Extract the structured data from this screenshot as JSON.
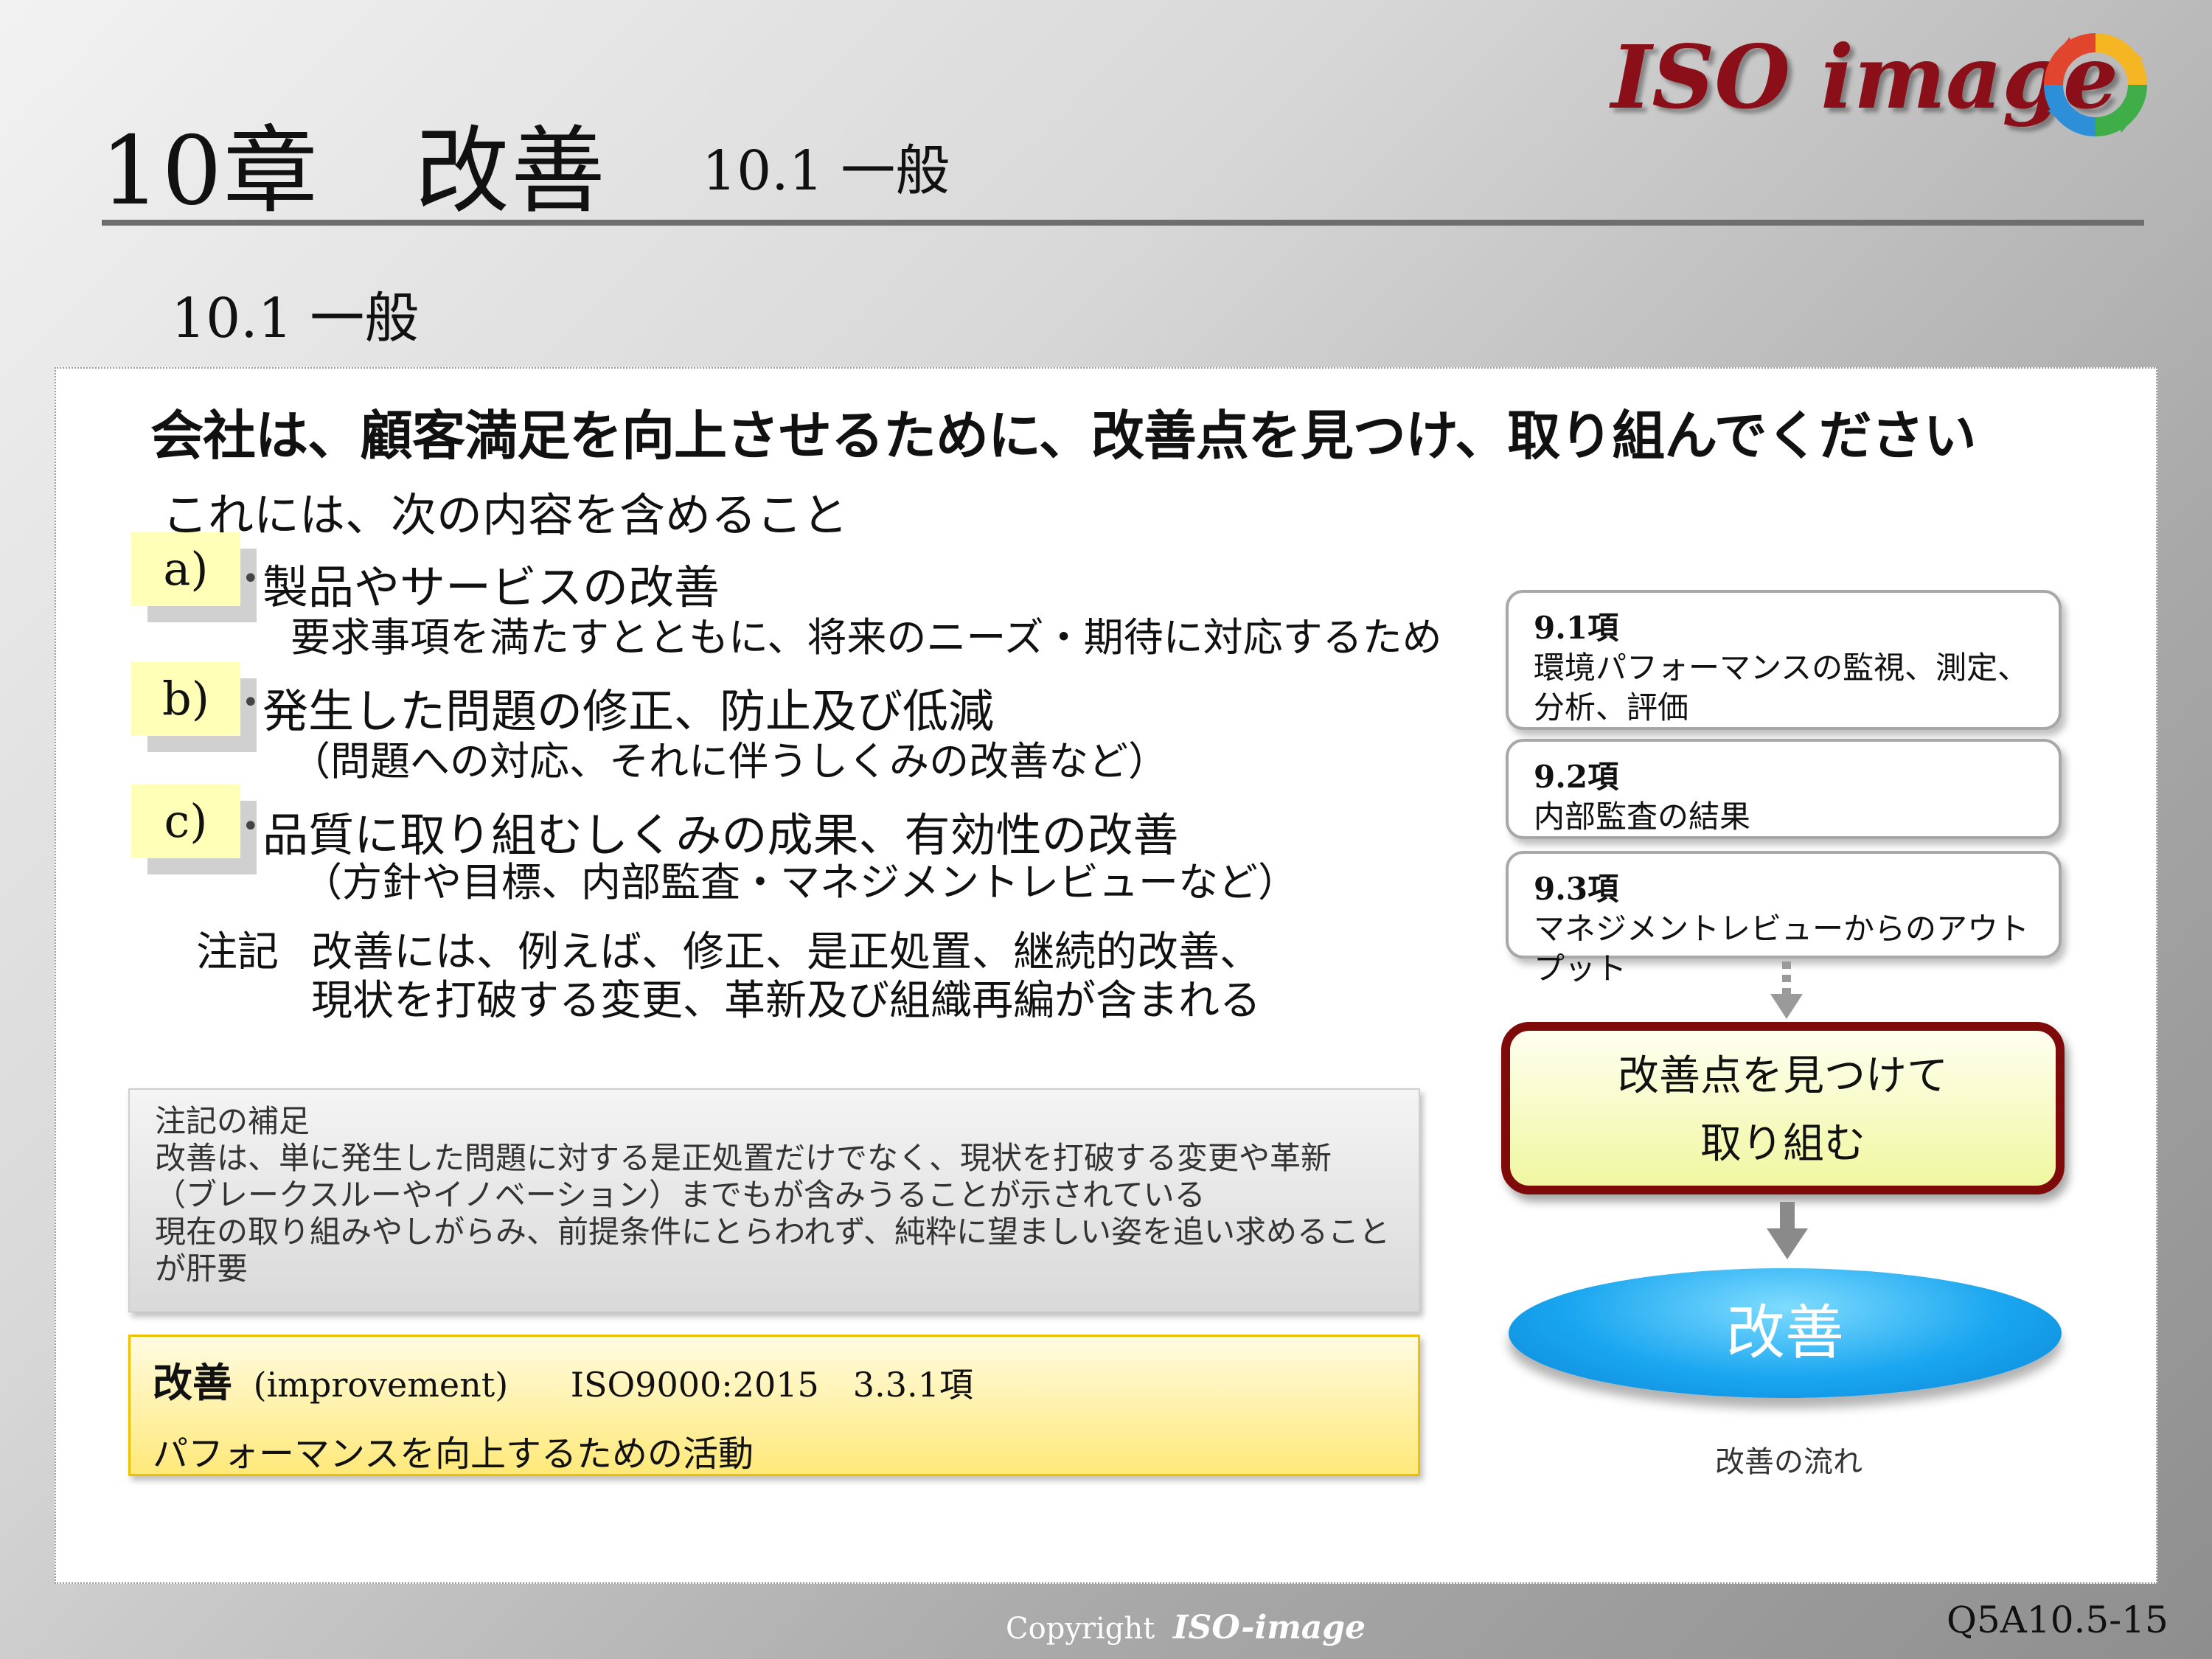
{
  "header": {
    "chapter_title": "10章　改善",
    "section_label": "10.1 一般",
    "logo_text": "ISO image"
  },
  "subsection_title": "10.1 一般",
  "main_statement": "会社は、顧客満足を向上させるために、改善点を見つけ、取り組んでください",
  "intro": "これには、次の内容を含めること",
  "items": [
    {
      "badge": "a)",
      "main": "製品やサービスの改善",
      "sub": "要求事項を満たすとともに、将来のニーズ・期待に対応するため"
    },
    {
      "badge": "b)",
      "main": "発生した問題の修正、防止及び低減",
      "sub": "（問題への対応、それに伴うしくみの改善など）"
    },
    {
      "badge": "c)",
      "main": "品質に取り組むしくみの成果、有効性の改善",
      "sub": "（方針や目標、内部監査・マネジメントレビューなど）"
    }
  ],
  "note": {
    "label": "注記",
    "lines": [
      "改善には、例えば、修正、是正処置、継続的改善、",
      "現状を打破する変更、革新及び組織再編が含まれる"
    ]
  },
  "supplement": {
    "title": "注記の補足",
    "lines": [
      "改善は、単に発生した問題に対する是正処置だけでなく、現状を打破する変更や革新",
      "（ブレークスルーやイノベーション）までもが含みうることが示されている",
      "現在の取り組みやしがらみ、前提条件にとらわれず、純粋に望ましい姿を追い求めること",
      "が肝要"
    ]
  },
  "definition": {
    "term": "改善",
    "term_en": "(improvement)",
    "reference": "ISO9000:2015　3.3.1項",
    "text": "パフォーマンスを向上するための活動"
  },
  "flow": {
    "inputs": [
      {
        "head": "9.1項",
        "lines": [
          "環境パフォーマンスの監視、測定、",
          "分析、評価"
        ]
      },
      {
        "head": "9.2項",
        "lines": [
          "内部監査の結果"
        ]
      },
      {
        "head": "9.3項",
        "lines": [
          "マネジメントレビューからのアウトプット"
        ]
      }
    ],
    "action_lines": [
      "改善点を見つけて",
      "取り組む"
    ],
    "result": "改善",
    "caption": "改善の流れ"
  },
  "footer": {
    "copyright_label": "Copyright",
    "copyright_logo": "ISO-image",
    "page_code": "Q5A10.5-15"
  },
  "colors": {
    "badge_bg": "#ffffb8",
    "highlight_border": "#7e0a0a",
    "result_fill": "#1aa6f0",
    "logo_text": "#8b0f18"
  }
}
